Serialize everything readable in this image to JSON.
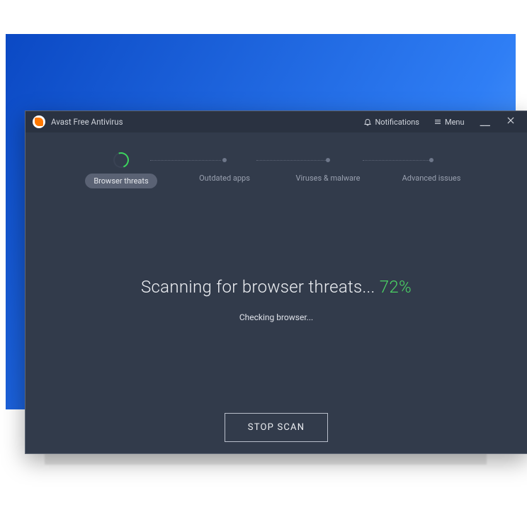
{
  "titlebar": {
    "app_name": "Avast Free Antivirus",
    "notifications_label": "Notifications",
    "menu_label": "Menu"
  },
  "stepper": {
    "steps": [
      {
        "label": "Browser threats",
        "active": true
      },
      {
        "label": "Outdated apps",
        "active": false
      },
      {
        "label": "Viruses & malware",
        "active": false
      },
      {
        "label": "Advanced issues",
        "active": false
      }
    ]
  },
  "main": {
    "scan_text": "Scanning for browser threats... ",
    "scan_percent": "72%",
    "status_text": "Checking browser...",
    "stop_label": "STOP SCAN"
  }
}
